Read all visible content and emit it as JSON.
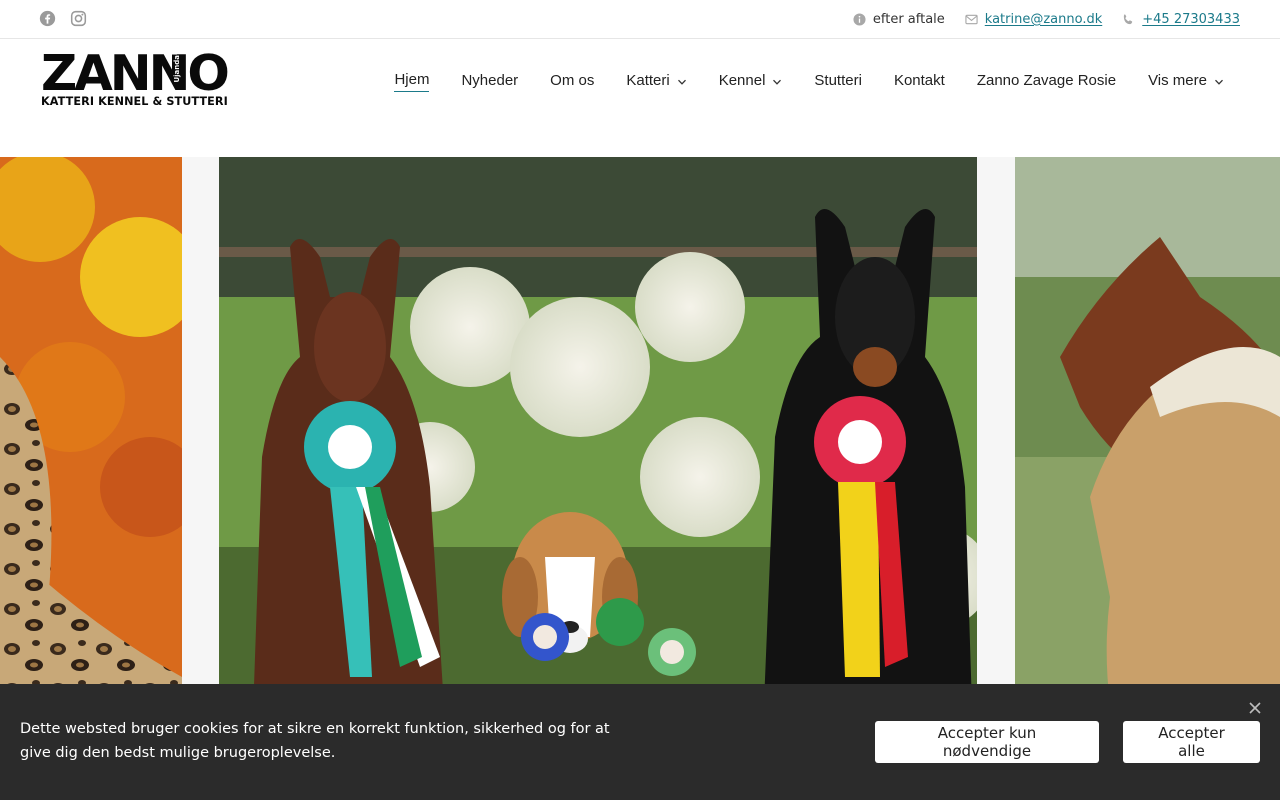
{
  "topbar": {
    "social": [
      {
        "icon": "facebook-icon"
      },
      {
        "icon": "instagram-icon"
      }
    ],
    "hours": "efter aftale",
    "email": "katrine@zanno.dk",
    "phone": "+45 27303433"
  },
  "logo": {
    "main": "ZANNO",
    "tiny": "Ujanda",
    "sub": "KATTERI KENNEL & STUTTERI"
  },
  "nav": {
    "items": [
      {
        "label": "Hjem",
        "active": true,
        "dropdown": false
      },
      {
        "label": "Nyheder",
        "dropdown": false
      },
      {
        "label": "Om os",
        "dropdown": false
      },
      {
        "label": "Katteri",
        "dropdown": true
      },
      {
        "label": "Kennel",
        "dropdown": true
      },
      {
        "label": "Stutteri",
        "dropdown": false
      },
      {
        "label": "Kontakt",
        "dropdown": false
      },
      {
        "label": "Zanno Zavage Rosie",
        "dropdown": false
      },
      {
        "label": "Vis mere",
        "dropdown": true
      }
    ]
  },
  "cookie": {
    "message": "Dette websted bruger cookies for at sikre en korrekt funktion, sikkerhed og for at give dig den bedst mulige brugeroplevelse.",
    "necessary_label": "Accepter kun nødvendige",
    "all_label": "Accepter alle"
  },
  "colors": {
    "accent": "#1b7a8a",
    "banner_bg": "#2b2b2b"
  }
}
